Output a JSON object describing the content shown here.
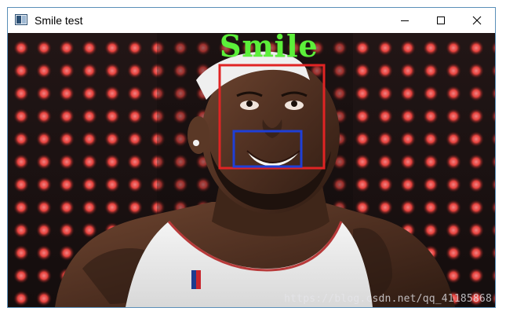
{
  "window": {
    "title": "Smile test",
    "controls": {
      "minimize_icon": "minimize-icon",
      "maximize_icon": "maximize-icon",
      "close_icon": "close-icon"
    }
  },
  "image": {
    "overlay_label": "Smile",
    "watermark": "https://blog.csdn.net/qq_41185868",
    "face_box_color": "#e02424",
    "mouth_box_color": "#1f3fd6",
    "label_color": "#5cf03a"
  }
}
